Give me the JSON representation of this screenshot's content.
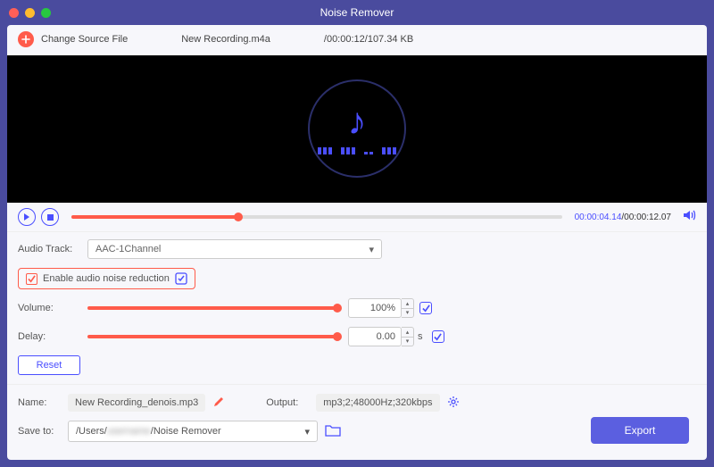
{
  "app": {
    "title": "Noise Remover"
  },
  "source": {
    "change_label": "Change Source File",
    "filename": "New Recording.m4a",
    "info": "/00:00:12/107.34 KB"
  },
  "player": {
    "current_time": "00:00:04.14",
    "total_time": "/00:00:12.07"
  },
  "tracks": {
    "label": "Audio Track:",
    "selected": "AAC-1Channel"
  },
  "enable": {
    "label": "Enable audio noise reduction"
  },
  "volume": {
    "label": "Volume:",
    "value": "100%"
  },
  "delay": {
    "label": "Delay:",
    "value": "0.00",
    "unit": "s"
  },
  "reset": {
    "label": "Reset"
  },
  "output": {
    "name_label": "Name:",
    "name_value": "New Recording_denois.mp3",
    "output_label": "Output:",
    "output_value": "mp3;2;48000Hz;320kbps",
    "save_label": "Save to:",
    "save_prefix": "/Users/",
    "save_suffix": "/Noise Remover"
  },
  "export": {
    "label": "Export"
  }
}
